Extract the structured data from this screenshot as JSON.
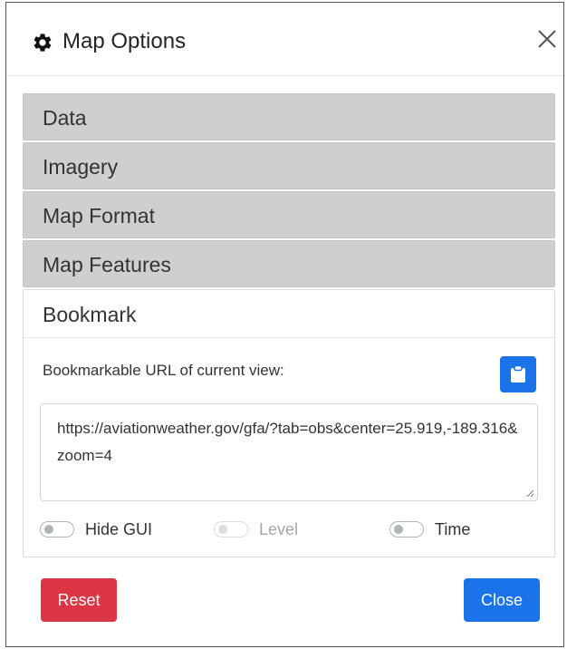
{
  "dialog": {
    "title": "Map Options",
    "icon": "gear-icon",
    "close_icon": "close-icon"
  },
  "accordion": {
    "sections": [
      {
        "label": "Data",
        "expanded": false
      },
      {
        "label": "Imagery",
        "expanded": false
      },
      {
        "label": "Map Format",
        "expanded": false
      },
      {
        "label": "Map Features",
        "expanded": false
      }
    ],
    "open_section": {
      "label": "Bookmark",
      "expanded": true,
      "url_label": "Bookmarkable URL of current view:",
      "copy_icon": "clipboard-icon",
      "url_value": "https://aviationweather.gov/gfa/?tab=obs&center=25.919,-189.316&zoom=4",
      "toggles": [
        {
          "label": "Hide GUI",
          "checked": false,
          "disabled": false
        },
        {
          "label": "Level",
          "checked": false,
          "disabled": true
        },
        {
          "label": "Time",
          "checked": false,
          "disabled": false
        }
      ]
    }
  },
  "footer": {
    "reset_label": "Reset",
    "close_label": "Close"
  },
  "colors": {
    "primary": "#1a73e8",
    "danger": "#dc3545",
    "section_bg": "#cfcfcf"
  }
}
